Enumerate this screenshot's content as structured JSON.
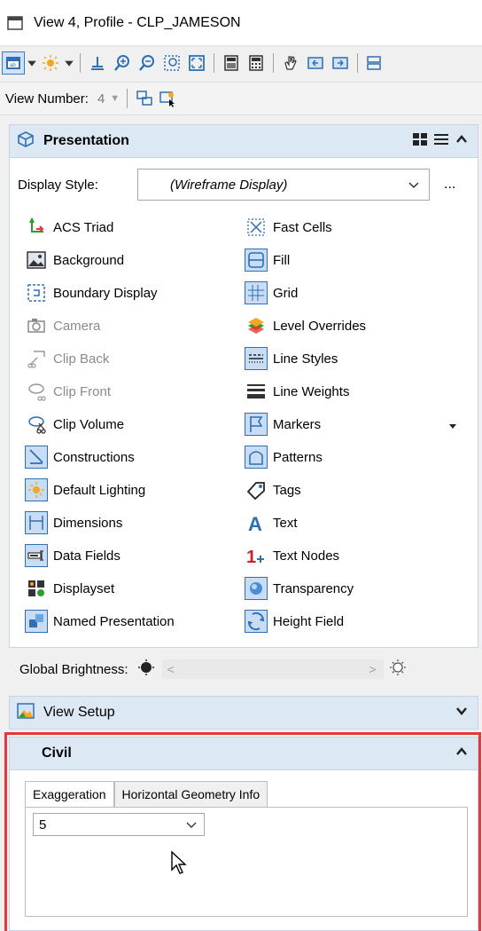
{
  "window": {
    "title": "View 4, Profile - CLP_JAMESON"
  },
  "toolbar": {
    "icons": [
      "view-attributes-icon",
      "dropdown-caret-icon",
      "lighting-icon",
      "dropdown-caret-icon",
      "camera-icon",
      "zoom-in-icon",
      "zoom-out-icon",
      "window-area-icon",
      "fit-view-icon",
      "view-previous-icon",
      "view-next-icon",
      "pan-view-icon",
      "copy-view-icon",
      "update-view-icon",
      "more-icon"
    ]
  },
  "view_number": {
    "label": "View Number:",
    "value": "4"
  },
  "presentation": {
    "title": "Presentation",
    "display_style_label": "Display Style:",
    "display_style_value": "(Wireframe Display)",
    "more_label": "...",
    "left_items": [
      {
        "label": "ACS Triad",
        "icon": "acs-triad-icon",
        "disabled": false
      },
      {
        "label": "Background",
        "icon": "background-icon",
        "disabled": false
      },
      {
        "label": "Boundary Display",
        "icon": "boundary-display-icon",
        "disabled": false
      },
      {
        "label": "Camera",
        "icon": "camera-icon",
        "disabled": true
      },
      {
        "label": "Clip Back",
        "icon": "clip-back-icon",
        "disabled": true
      },
      {
        "label": "Clip Front",
        "icon": "clip-front-icon",
        "disabled": true
      },
      {
        "label": "Clip Volume",
        "icon": "clip-volume-icon",
        "disabled": false
      },
      {
        "label": "Constructions",
        "icon": "constructions-icon",
        "disabled": false
      },
      {
        "label": "Default Lighting",
        "icon": "default-lighting-icon",
        "disabled": false
      },
      {
        "label": "Dimensions",
        "icon": "dimensions-icon",
        "disabled": false
      },
      {
        "label": "Data Fields",
        "icon": "data-fields-icon",
        "disabled": false
      },
      {
        "label": "Displayset",
        "icon": "displayset-icon",
        "disabled": false
      },
      {
        "label": "Named Presentation",
        "icon": "named-presentation-icon",
        "disabled": false
      }
    ],
    "right_items": [
      {
        "label": "Fast Cells",
        "icon": "fast-cells-icon"
      },
      {
        "label": "Fill",
        "icon": "fill-icon"
      },
      {
        "label": "Grid",
        "icon": "grid-icon"
      },
      {
        "label": "Level Overrides",
        "icon": "level-overrides-icon"
      },
      {
        "label": "Line Styles",
        "icon": "line-styles-icon"
      },
      {
        "label": "Line Weights",
        "icon": "line-weights-icon"
      },
      {
        "label": "Markers",
        "icon": "markers-icon"
      },
      {
        "label": "Patterns",
        "icon": "patterns-icon"
      },
      {
        "label": "Tags",
        "icon": "tags-icon"
      },
      {
        "label": "Text",
        "icon": "text-icon"
      },
      {
        "label": "Text Nodes",
        "icon": "text-nodes-icon"
      },
      {
        "label": "Transparency",
        "icon": "transparency-icon"
      },
      {
        "label": "Height Field",
        "icon": "height-field-icon"
      }
    ],
    "brightness_label": "Global Brightness:"
  },
  "view_setup": {
    "title": "View Setup"
  },
  "civil": {
    "title": "Civil",
    "tabs": [
      "Exaggeration",
      "Horizontal Geometry Info"
    ],
    "active_tab": "Exaggeration",
    "exaggeration_value": "5"
  },
  "colors": {
    "panel_header": "#dde8f5",
    "accent": "#2f6fb3",
    "highlight": "#e5383b"
  }
}
